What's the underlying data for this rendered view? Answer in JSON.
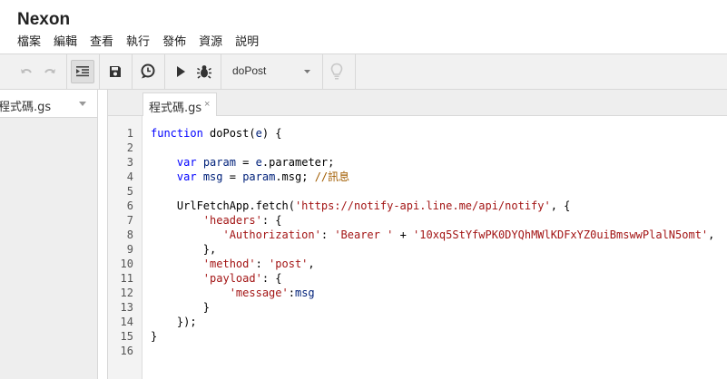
{
  "app": {
    "title": "Nexon"
  },
  "menu": [
    {
      "label": "檔案"
    },
    {
      "label": "編輯"
    },
    {
      "label": "查看"
    },
    {
      "label": "執行"
    },
    {
      "label": "發佈"
    },
    {
      "label": "資源"
    },
    {
      "label": "説明"
    }
  ],
  "toolbar": {
    "function_select": {
      "value": "doPost"
    },
    "icons": [
      "undo-icon",
      "redo-icon",
      "indent-icon",
      "save-icon",
      "clock-trigger-icon",
      "run-icon",
      "debug-bug-icon",
      "lightbulb-icon"
    ]
  },
  "file_panel": {
    "file_name": "程式碼.gs"
  },
  "tabs": [
    {
      "label": "程式碼.gs",
      "close": "×"
    }
  ],
  "editor": {
    "line_numbers": [
      "1",
      "2",
      "3",
      "4",
      "5",
      "6",
      "7",
      "8",
      "9",
      "10",
      "11",
      "12",
      "13",
      "14",
      "15",
      "16"
    ],
    "lines": [
      [
        {
          "t": "kw",
          "v": "function"
        },
        {
          "t": "plain",
          "v": " doPost("
        },
        {
          "t": "var",
          "v": "e"
        },
        {
          "t": "plain",
          "v": ") {"
        }
      ],
      [],
      [
        {
          "t": "plain",
          "v": "    "
        },
        {
          "t": "kw",
          "v": "var"
        },
        {
          "t": "plain",
          "v": " "
        },
        {
          "t": "var",
          "v": "param"
        },
        {
          "t": "plain",
          "v": " = "
        },
        {
          "t": "var",
          "v": "e"
        },
        {
          "t": "plain",
          "v": ".parameter;"
        }
      ],
      [
        {
          "t": "plain",
          "v": "    "
        },
        {
          "t": "kw",
          "v": "var"
        },
        {
          "t": "plain",
          "v": " "
        },
        {
          "t": "var",
          "v": "msg"
        },
        {
          "t": "plain",
          "v": " = "
        },
        {
          "t": "var",
          "v": "param"
        },
        {
          "t": "plain",
          "v": ".msg; "
        },
        {
          "t": "cmt",
          "v": "//訊息"
        }
      ],
      [],
      [
        {
          "t": "plain",
          "v": "    UrlFetchApp.fetch("
        },
        {
          "t": "str",
          "v": "'https://notify-api.line.me/api/notify'"
        },
        {
          "t": "plain",
          "v": ", {"
        }
      ],
      [
        {
          "t": "plain",
          "v": "        "
        },
        {
          "t": "str",
          "v": "'headers'"
        },
        {
          "t": "plain",
          "v": ": {"
        }
      ],
      [
        {
          "t": "plain",
          "v": "           "
        },
        {
          "t": "str",
          "v": "'Authorization'"
        },
        {
          "t": "plain",
          "v": ": "
        },
        {
          "t": "str",
          "v": "'Bearer '"
        },
        {
          "t": "plain",
          "v": " + "
        },
        {
          "t": "str",
          "v": "'10xq5StYfwPK0DYQhMWlKDFxYZ0uiBmswwPlalN5omt'"
        },
        {
          "t": "plain",
          "v": ","
        }
      ],
      [
        {
          "t": "plain",
          "v": "        },"
        }
      ],
      [
        {
          "t": "plain",
          "v": "        "
        },
        {
          "t": "str",
          "v": "'method'"
        },
        {
          "t": "plain",
          "v": ": "
        },
        {
          "t": "str",
          "v": "'post'"
        },
        {
          "t": "plain",
          "v": ","
        }
      ],
      [
        {
          "t": "plain",
          "v": "        "
        },
        {
          "t": "str",
          "v": "'payload'"
        },
        {
          "t": "plain",
          "v": ": {"
        }
      ],
      [
        {
          "t": "plain",
          "v": "            "
        },
        {
          "t": "str",
          "v": "'message'"
        },
        {
          "t": "plain",
          "v": ":"
        },
        {
          "t": "var",
          "v": "msg"
        }
      ],
      [
        {
          "t": "plain",
          "v": "        }"
        }
      ],
      [
        {
          "t": "plain",
          "v": "    });"
        }
      ],
      [
        {
          "t": "plain",
          "v": "}"
        }
      ],
      []
    ]
  },
  "colors": {
    "keyword": "#0000ff",
    "string": "#a31515",
    "variable": "#00217a",
    "comment": "#a15c00"
  }
}
